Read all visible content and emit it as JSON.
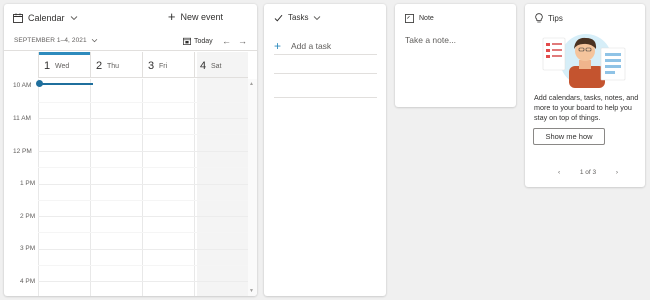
{
  "calendar": {
    "title": "Calendar",
    "new_event_label": "New event",
    "date_range": "SEPTEMBER 1–4, 2021",
    "today_label": "Today",
    "days": [
      {
        "num": "1",
        "name": "Wed",
        "selected": true
      },
      {
        "num": "2",
        "name": "Thu",
        "selected": false
      },
      {
        "num": "3",
        "name": "Fri",
        "selected": false
      },
      {
        "num": "4",
        "name": "Sat",
        "selected": false
      }
    ],
    "times": [
      "10 AM",
      "11 AM",
      "12 PM",
      "1 PM",
      "2 PM",
      "3 PM",
      "4 PM"
    ]
  },
  "tasks": {
    "title": "Tasks",
    "add_task_label": "Add a task"
  },
  "note": {
    "title": "Note",
    "placeholder": "Take a note..."
  },
  "tips": {
    "title": "Tips",
    "text": "Add calendars, tasks, notes, and more to your board to help you stay on top of things.",
    "button_label": "Show me how",
    "pager": "1 of 3"
  },
  "colors": {
    "accent": "#2e8bbd",
    "now_indicator": "#1f6f9d",
    "background": "#f0f0f0"
  }
}
